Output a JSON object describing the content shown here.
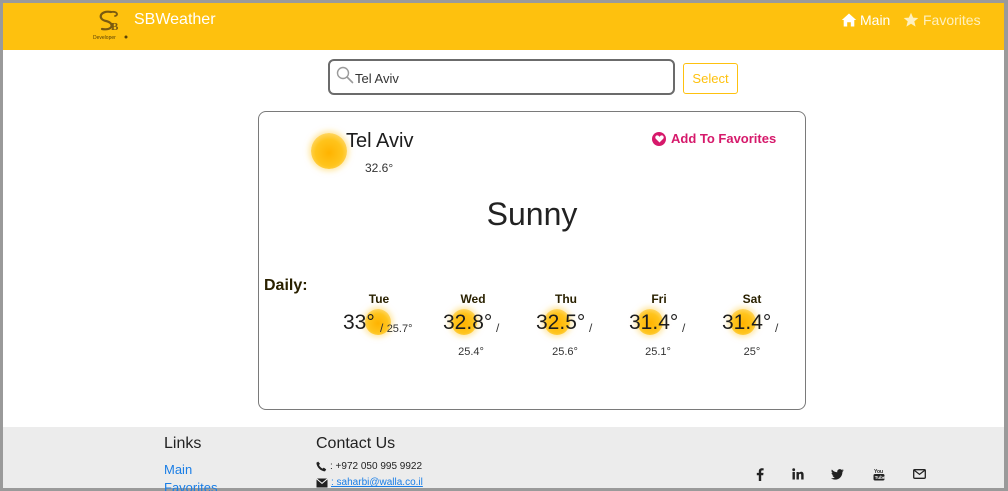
{
  "navbar": {
    "brand_name": "SBWeather",
    "brand_logo_icon": "sb-developer-logo",
    "main_label": "Main",
    "main_icon": "home-icon",
    "favorites_label": "Favorites",
    "favorites_icon": "star-icon",
    "background_color": "#fec10e"
  },
  "search": {
    "value": "Tel Aviv",
    "icon": "search-icon",
    "select_label": "Select"
  },
  "current": {
    "city": "Tel Aviv",
    "temperature": "32.6°",
    "condition": "Sunny",
    "icon": "sun-icon",
    "add_favorites_label": "Add To Favorites",
    "favorites_color": "#d6196b"
  },
  "daily": {
    "label": "Daily:",
    "days": [
      {
        "name": "Tue",
        "max": "33°",
        "min": "25.7°",
        "icon": "sun-icon"
      },
      {
        "name": "Wed",
        "max": "32.8°",
        "min": "25.4°",
        "icon": "sun-icon"
      },
      {
        "name": "Thu",
        "max": "32.5°",
        "min": "25.6°",
        "icon": "sun-icon"
      },
      {
        "name": "Fri",
        "max": "31.4°",
        "min": "25.1°",
        "icon": "sun-icon"
      },
      {
        "name": "Sat",
        "max": "31.4°",
        "min": "25°",
        "icon": "sun-icon"
      }
    ],
    "separator": "/"
  },
  "footer": {
    "links_heading": "Links",
    "links": [
      "Main",
      "Favorites"
    ],
    "contact_heading": "Contact Us",
    "phone": ": +972 050 995 9922",
    "email": ": saharbi@walla.co.il",
    "social_icons": [
      "facebook-icon",
      "linkedin-icon",
      "twitter-icon",
      "youtube-icon",
      "envelope-icon"
    ]
  }
}
